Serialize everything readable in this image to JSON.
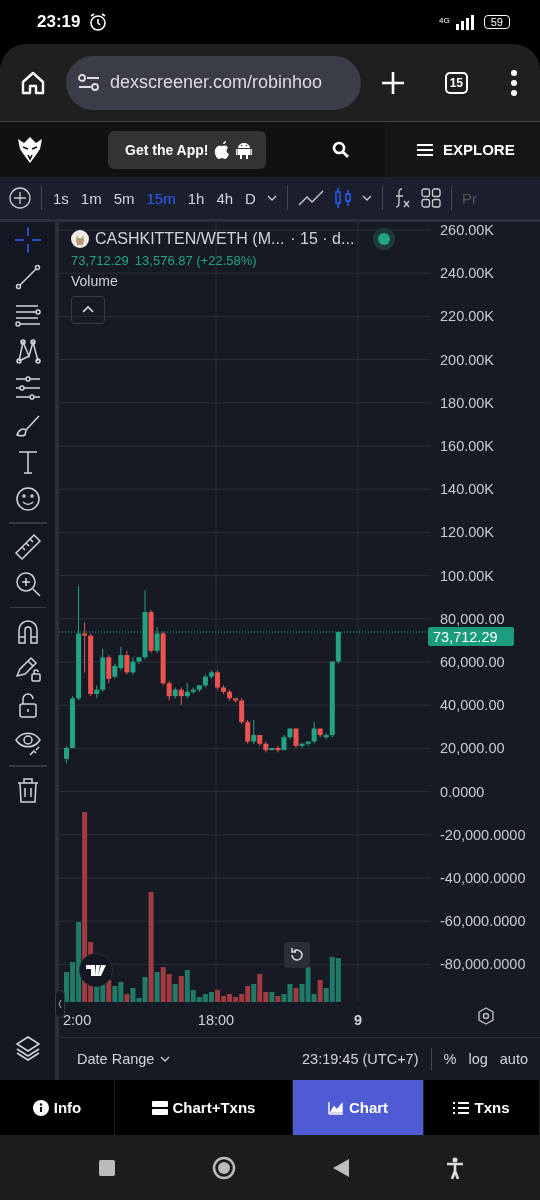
{
  "status_bar": {
    "time": "23:19",
    "network": "4G",
    "battery": "59"
  },
  "browser": {
    "url": "dexscreener.com/robinhoo",
    "tab_count": "15"
  },
  "site_header": {
    "app_button": "Get the App!",
    "explore": "EXPLORE"
  },
  "toolbar": {
    "timeframes": [
      {
        "label": "1s",
        "selected": false
      },
      {
        "label": "1m",
        "selected": false
      },
      {
        "label": "5m",
        "selected": false
      },
      {
        "label": "15m",
        "selected": true
      },
      {
        "label": "1h",
        "selected": false
      },
      {
        "label": "4h",
        "selected": false
      },
      {
        "label": "D",
        "selected": false
      }
    ],
    "chart_styles": [
      {
        "kind": "line",
        "selected": false
      },
      {
        "kind": "candles",
        "selected": true
      }
    ],
    "cut_off_item": "Pr"
  },
  "drawing_tools": [
    {
      "kind": "crosshair",
      "selected": true
    },
    {
      "kind": "trend-line",
      "selected": false
    },
    {
      "kind": "fib",
      "selected": false
    },
    {
      "kind": "pattern",
      "selected": false
    },
    {
      "kind": "projection",
      "selected": false
    },
    {
      "kind": "brush",
      "selected": false
    },
    {
      "kind": "text",
      "selected": false
    },
    {
      "kind": "emoji",
      "selected": false
    },
    {
      "kind": "divider"
    },
    {
      "kind": "ruler",
      "selected": false
    },
    {
      "kind": "zoom",
      "selected": false
    },
    {
      "kind": "divider"
    },
    {
      "kind": "magnet",
      "selected": false
    },
    {
      "kind": "lock-drawing",
      "selected": false
    },
    {
      "kind": "lock",
      "selected": false
    },
    {
      "kind": "eye",
      "selected": false
    },
    {
      "kind": "divider"
    },
    {
      "kind": "trash",
      "selected": false
    }
  ],
  "legend": {
    "symbol": "CASHKITTEN/WETH (M...",
    "interval": "· 15 · d...",
    "live": true,
    "last": "73,712.29",
    "change": "13,576.87 (+22.58%)",
    "volume_label": "Volume"
  },
  "y_axis": [
    "260.00K",
    "240.00K",
    "220.00K",
    "200.00K",
    "180.00K",
    "160.00K",
    "140.00K",
    "120.00K",
    "100.00K",
    "80,000.00",
    "60,000.00",
    "40,000.00",
    "20,000.00",
    "0.0000",
    "-20,000.0000",
    "-40,000.0000",
    "-60,000.0000",
    "-80,000.0000"
  ],
  "price_tag": "73,712.29",
  "x_axis": [
    {
      "label": "2:00",
      "bold": false
    },
    {
      "label": "18:00",
      "bold": false
    },
    {
      "label": "9",
      "bold": true
    }
  ],
  "footer": {
    "date_range": "Date Range",
    "clock": "23:19:45 (UTC+7)",
    "options": [
      "%",
      "log",
      "auto"
    ]
  },
  "bottom_tabs": [
    {
      "kind": "info",
      "label": "Info",
      "selected": false
    },
    {
      "kind": "split",
      "label": "Chart+Txns",
      "selected": false
    },
    {
      "kind": "chart",
      "label": "Chart",
      "selected": true
    },
    {
      "kind": "list",
      "label": "Txns",
      "selected": false
    }
  ]
}
